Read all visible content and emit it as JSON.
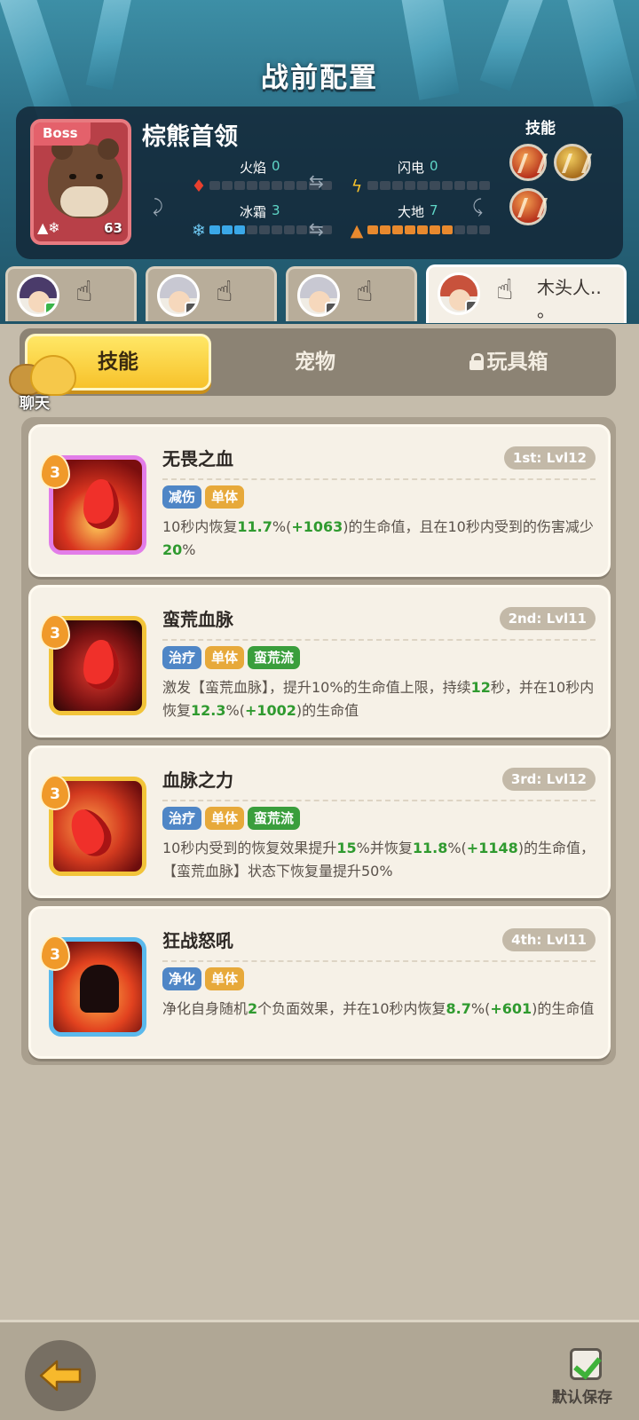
{
  "header": {
    "title": "战前配置"
  },
  "boss": {
    "tag": "Boss",
    "name": "棕熊首领",
    "level": "63",
    "elements": [
      {
        "label": "火焰",
        "value": "0",
        "filled": 0,
        "color": "blue"
      },
      {
        "label": "闪电",
        "value": "0",
        "filled": 0,
        "color": "blue"
      },
      {
        "label": "冰霜",
        "value": "3",
        "filled": 3,
        "color": "blue"
      },
      {
        "label": "大地",
        "value": "7",
        "filled": 7,
        "color": "orange"
      }
    ],
    "skills_label": "技能",
    "skill_icons": [
      "claw-skill-icon",
      "gold-beast-skill-icon",
      "claw-skill-icon"
    ]
  },
  "heroes": [
    {
      "avatar_hair": "#4a3b6a",
      "name": ""
    },
    {
      "avatar_hair": "#c8c8d2",
      "name": ""
    },
    {
      "avatar_hair": "#c8c8d2",
      "name": ""
    },
    {
      "avatar_hair": "#c8523c",
      "name": "木头人.. 。"
    }
  ],
  "tabs": {
    "skills": "技能",
    "pets": "宠物",
    "toybox": "玩具箱"
  },
  "chat": {
    "label": "聊天"
  },
  "cards": [
    {
      "title": "无畏之血",
      "rank": "1st: Lvl12",
      "level": "3",
      "tags": [
        {
          "text": "减伤",
          "color": "blue"
        },
        {
          "text": "单体",
          "color": "yellow"
        }
      ],
      "desc": [
        {
          "t": "10秒内恢复"
        },
        {
          "t": "11.7",
          "hl": true
        },
        {
          "t": "%("
        },
        {
          "t": "+1063",
          "hl": true
        },
        {
          "t": ")的生命值，且在10秒内受到的伤害减少"
        },
        {
          "t": "20",
          "hl": true
        },
        {
          "t": "%"
        }
      ]
    },
    {
      "title": "蛮荒血脉",
      "rank": "2nd: Lvl11",
      "level": "3",
      "tags": [
        {
          "text": "治疗",
          "color": "blue"
        },
        {
          "text": "单体",
          "color": "yellow"
        },
        {
          "text": "蛮荒流",
          "color": "green"
        }
      ],
      "desc": [
        {
          "t": "激发【蛮荒血脉】，提升10%的生命值上限，持续"
        },
        {
          "t": "12",
          "hl": true
        },
        {
          "t": "秒，并在10秒内恢复"
        },
        {
          "t": "12.3",
          "hl": true
        },
        {
          "t": "%("
        },
        {
          "t": "+1002",
          "hl": true
        },
        {
          "t": ")的生命值"
        }
      ]
    },
    {
      "title": "血脉之力",
      "rank": "3rd: Lvl12",
      "level": "3",
      "tags": [
        {
          "text": "治疗",
          "color": "blue"
        },
        {
          "text": "单体",
          "color": "yellow"
        },
        {
          "text": "蛮荒流",
          "color": "green"
        }
      ],
      "desc": [
        {
          "t": "10秒内受到的恢复效果提升"
        },
        {
          "t": "15",
          "hl": true
        },
        {
          "t": "%并恢复"
        },
        {
          "t": "11.8",
          "hl": true
        },
        {
          "t": "%("
        },
        {
          "t": "+1148",
          "hl": true
        },
        {
          "t": ")的生命值，【蛮荒血脉】状态下恢复量提升50%"
        }
      ]
    },
    {
      "title": "狂战怒吼",
      "rank": "4th: Lvl11",
      "level": "3",
      "tags": [
        {
          "text": "净化",
          "color": "blue"
        },
        {
          "text": "单体",
          "color": "yellow"
        }
      ],
      "desc": [
        {
          "t": "净化自身随机"
        },
        {
          "t": "2",
          "hl": true
        },
        {
          "t": "个负面效果，并在10秒内恢复"
        },
        {
          "t": "8.7",
          "hl": true
        },
        {
          "t": "%("
        },
        {
          "t": "+601",
          "hl": true
        },
        {
          "t": ")的生命值"
        }
      ]
    }
  ],
  "footer": {
    "save_label": "默认保存"
  }
}
